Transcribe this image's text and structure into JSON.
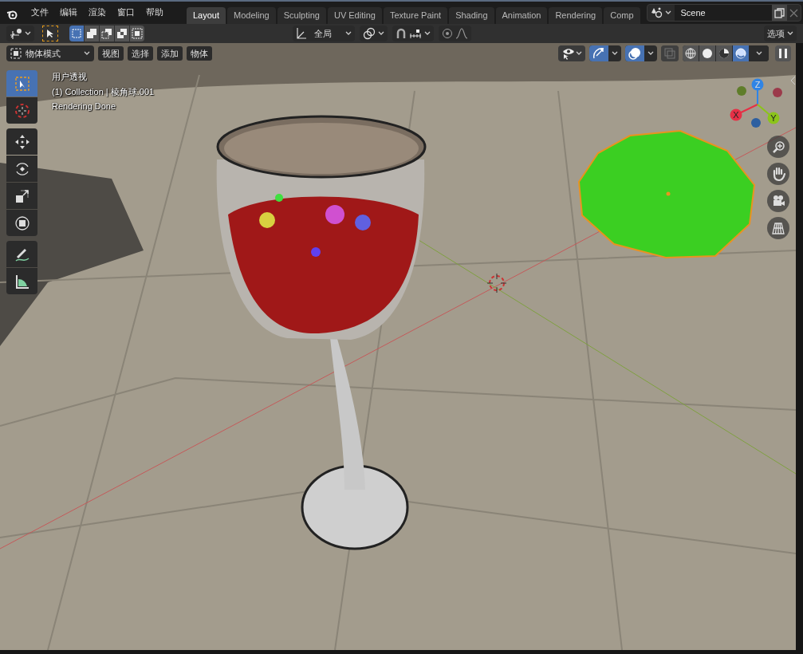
{
  "menu_bar": {
    "items": [
      "文件",
      "编辑",
      "渲染",
      "窗口",
      "帮助"
    ]
  },
  "workspace_tabs": [
    {
      "label": "Layout",
      "selected": true
    },
    {
      "label": "Modeling",
      "selected": false
    },
    {
      "label": "Sculpting",
      "selected": false
    },
    {
      "label": "UV Editing",
      "selected": false
    },
    {
      "label": "Texture Paint",
      "selected": false
    },
    {
      "label": "Shading",
      "selected": false
    },
    {
      "label": "Animation",
      "selected": false
    },
    {
      "label": "Rendering",
      "selected": false
    },
    {
      "label": "Comp",
      "selected": false
    }
  ],
  "scene": {
    "name": "Scene"
  },
  "tool_header": {
    "select_modes": [
      {
        "selected": true
      },
      {
        "selected": false
      },
      {
        "selected": false
      },
      {
        "selected": false
      },
      {
        "selected": false
      }
    ],
    "orientation": "全局",
    "snap": {
      "on": false
    },
    "proportional_edit": {
      "on": false
    },
    "options": "选项"
  },
  "viewport": {
    "mode": "物体模式",
    "menus": [
      "视图",
      "选择",
      "添加",
      "物体"
    ],
    "gizmos": {
      "on": true
    },
    "overlays": {
      "on": true
    },
    "xray": {
      "on": false
    },
    "shading_modes": [
      {
        "selected": false
      },
      {
        "selected": false
      },
      {
        "selected": false
      },
      {
        "selected": true
      }
    ],
    "info": [
      "用户透视",
      "(1) Collection | 棱角球.001",
      "Rendering Done"
    ],
    "tool_groups": [
      [
        {
          "kind": "select",
          "selected": true
        },
        {
          "kind": "cursor",
          "selected": false
        }
      ],
      [
        {
          "kind": "move",
          "selected": false
        },
        {
          "kind": "rotate",
          "selected": false
        },
        {
          "kind": "scale",
          "selected": false
        },
        {
          "kind": "transform",
          "selected": false
        }
      ],
      [
        {
          "kind": "annotate",
          "selected": false
        },
        {
          "kind": "measure",
          "selected": false
        }
      ]
    ],
    "axes": [
      {
        "label": "Z"
      },
      {
        "label": "X"
      },
      {
        "label": "Y"
      }
    ],
    "navigation": [
      {
        "kind": "zoom"
      },
      {
        "kind": "pan"
      },
      {
        "kind": "camera"
      },
      {
        "kind": "ortho"
      }
    ]
  }
}
